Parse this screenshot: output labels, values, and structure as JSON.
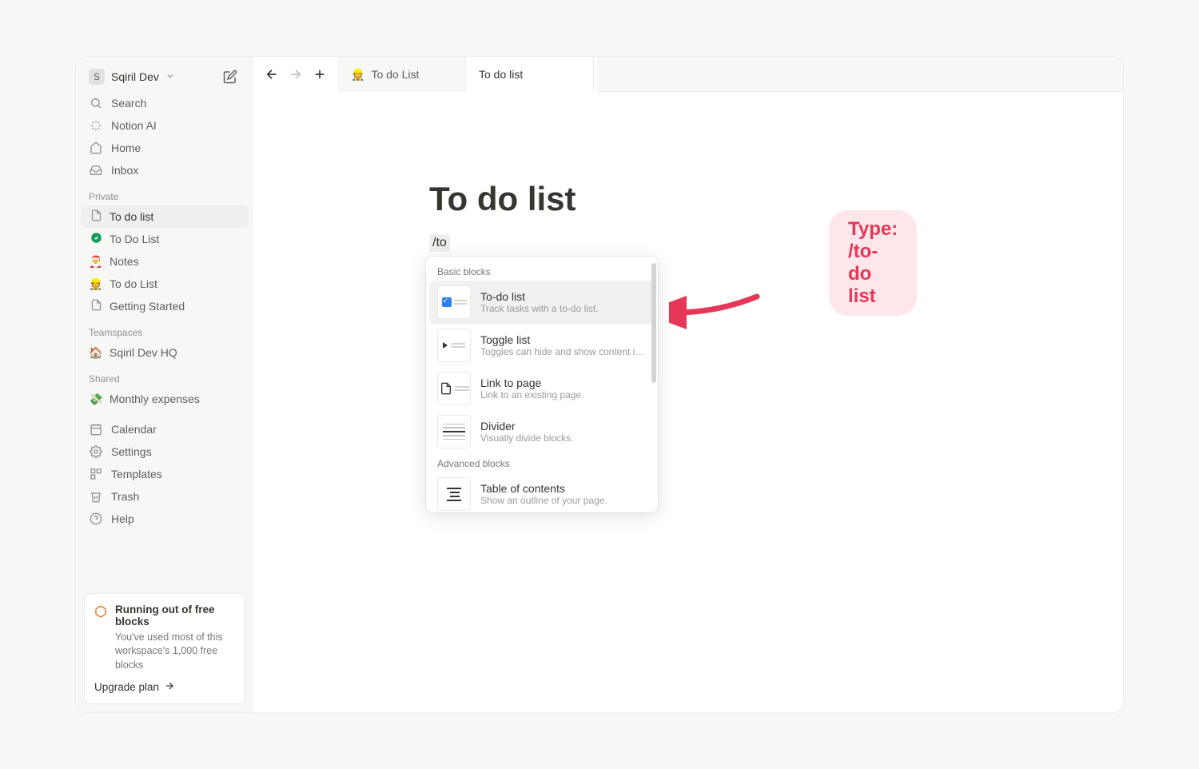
{
  "workspace": {
    "avatar_letter": "S",
    "name": "Sqiril Dev"
  },
  "nav": {
    "search": "Search",
    "ai": "Notion AI",
    "home": "Home",
    "inbox": "Inbox"
  },
  "sections": {
    "private": "Private",
    "teamspaces": "Teamspaces",
    "shared": "Shared"
  },
  "private_pages": [
    {
      "icon": "📄",
      "label": "To do list",
      "active": true,
      "icon_type": "page"
    },
    {
      "icon": "✅",
      "label": "To Do List",
      "icon_type": "check"
    },
    {
      "icon": "🎅",
      "label": "Notes"
    },
    {
      "icon": "👷",
      "label": "To do List"
    },
    {
      "icon": "📄",
      "label": "Getting Started",
      "icon_type": "page"
    }
  ],
  "teamspace_pages": [
    {
      "icon": "🏠",
      "label": "Sqiril Dev HQ"
    }
  ],
  "shared_pages": [
    {
      "icon": "💸",
      "label": "Monthly expenses"
    }
  ],
  "bottom_nav": {
    "calendar": "Calendar",
    "settings": "Settings",
    "templates": "Templates",
    "trash": "Trash",
    "help": "Help"
  },
  "promo": {
    "title": "Running out of free blocks",
    "subtitle": "You've used most of this workspace's 1,000 free blocks",
    "cta": "Upgrade plan"
  },
  "tabs": [
    {
      "icon": "👷",
      "label": "To do List",
      "active": false
    },
    {
      "icon": "",
      "label": "To do list",
      "active": true
    }
  ],
  "page": {
    "title": "To do list",
    "typed": "/to"
  },
  "callout": "Type: /to-do list",
  "slash_menu": {
    "section_basic": "Basic blocks",
    "section_advanced": "Advanced blocks",
    "items": [
      {
        "title": "To-do list",
        "desc": "Track tasks with a to-do list.",
        "selected": true,
        "thumb": "check"
      },
      {
        "title": "Toggle list",
        "desc": "Toggles can hide and show content in...",
        "thumb": "toggle"
      },
      {
        "title": "Link to page",
        "desc": "Link to an existing page.",
        "thumb": "link"
      },
      {
        "title": "Divider",
        "desc": "Visually divide blocks.",
        "thumb": "divider"
      }
    ],
    "advanced_items": [
      {
        "title": "Table of contents",
        "desc": "Show an outline of your page.",
        "thumb": "toc"
      }
    ]
  }
}
